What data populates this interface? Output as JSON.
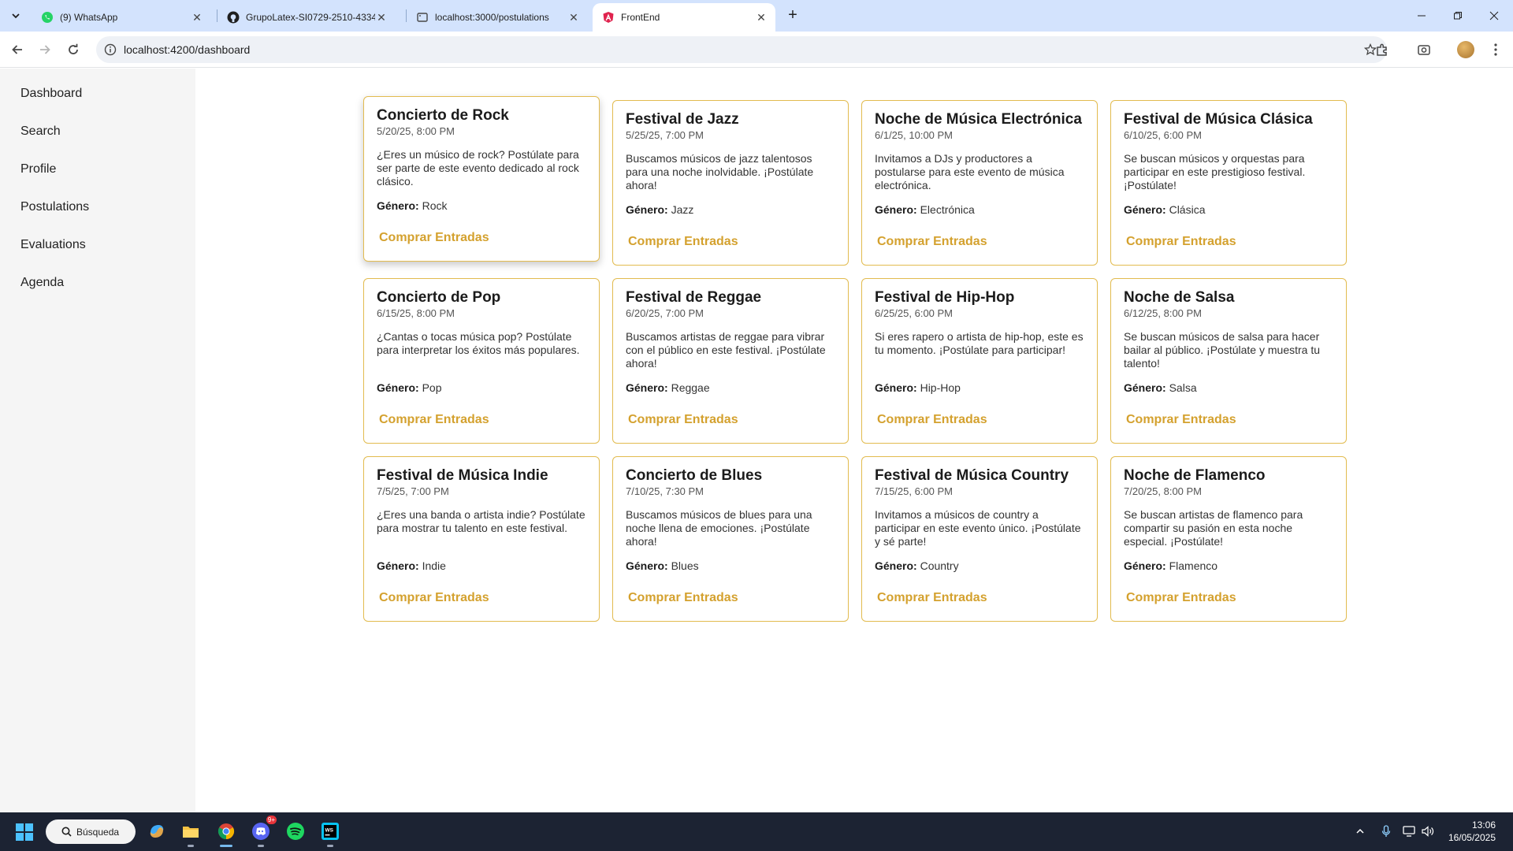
{
  "browser": {
    "tabs": [
      {
        "title": "(9) WhatsApp",
        "icon": "whatsapp-icon"
      },
      {
        "title": "GrupoLatex-SI0729-2510-4334",
        "icon": "github-icon"
      },
      {
        "title": "localhost:3000/postulations",
        "icon": "page-icon"
      },
      {
        "title": "FrontEnd",
        "icon": "angular-icon"
      }
    ],
    "url": "localhost:4200/dashboard"
  },
  "sidebar": {
    "items": [
      {
        "label": "Dashboard"
      },
      {
        "label": "Search"
      },
      {
        "label": "Profile"
      },
      {
        "label": "Postulations"
      },
      {
        "label": "Evaluations"
      },
      {
        "label": "Agenda"
      }
    ]
  },
  "events": [
    {
      "title": "Concierto de Rock",
      "date": "5/20/25, 8:00 PM",
      "description": "¿Eres un músico de rock? Postúlate para ser parte de este evento dedicado al rock clásico.",
      "genre_label": "Género:",
      "genre": "Rock",
      "button": "Comprar Entradas"
    },
    {
      "title": "Festival de Jazz",
      "date": "5/25/25, 7:00 PM",
      "description": "Buscamos músicos de jazz talentosos para una noche inolvidable. ¡Postúlate ahora!",
      "genre_label": "Género:",
      "genre": "Jazz",
      "button": "Comprar Entradas"
    },
    {
      "title": "Noche de Música Electrónica",
      "date": "6/1/25, 10:00 PM",
      "description": "Invitamos a DJs y productores a postularse para este evento de música electrónica.",
      "genre_label": "Género:",
      "genre": "Electrónica",
      "button": "Comprar Entradas"
    },
    {
      "title": "Festival de Música Clásica",
      "date": "6/10/25, 6:00 PM",
      "description": "Se buscan músicos y orquestas para participar en este prestigioso festival. ¡Postúlate!",
      "genre_label": "Género:",
      "genre": "Clásica",
      "button": "Comprar Entradas"
    },
    {
      "title": "Concierto de Pop",
      "date": "6/15/25, 8:00 PM",
      "description": "¿Cantas o tocas música pop? Postúlate para interpretar los éxitos más populares.",
      "genre_label": "Género:",
      "genre": "Pop",
      "button": "Comprar Entradas"
    },
    {
      "title": "Festival de Reggae",
      "date": "6/20/25, 7:00 PM",
      "description": "Buscamos artistas de reggae para vibrar con el público en este festival. ¡Postúlate ahora!",
      "genre_label": "Género:",
      "genre": "Reggae",
      "button": "Comprar Entradas"
    },
    {
      "title": "Festival de Hip-Hop",
      "date": "6/25/25, 6:00 PM",
      "description": "Si eres rapero o artista de hip-hop, este es tu momento. ¡Postúlate para participar!",
      "genre_label": "Género:",
      "genre": "Hip-Hop",
      "button": "Comprar Entradas"
    },
    {
      "title": "Noche de Salsa",
      "date": "6/12/25, 8:00 PM",
      "description": "Se buscan músicos de salsa para hacer bailar al público. ¡Postúlate y muestra tu talento!",
      "genre_label": "Género:",
      "genre": "Salsa",
      "button": "Comprar Entradas"
    },
    {
      "title": "Festival de Música Indie",
      "date": "7/5/25, 7:00 PM",
      "description": "¿Eres una banda o artista indie? Postúlate para mostrar tu talento en este festival.",
      "genre_label": "Género:",
      "genre": "Indie",
      "button": "Comprar Entradas"
    },
    {
      "title": "Concierto de Blues",
      "date": "7/10/25, 7:30 PM",
      "description": "Buscamos músicos de blues para una noche llena de emociones. ¡Postúlate ahora!",
      "genre_label": "Género:",
      "genre": "Blues",
      "button": "Comprar Entradas"
    },
    {
      "title": "Festival de Música Country",
      "date": "7/15/25, 6:00 PM",
      "description": "Invitamos a músicos de country a participar en este evento único. ¡Postúlate y sé parte!",
      "genre_label": "Género:",
      "genre": "Country",
      "button": "Comprar Entradas"
    },
    {
      "title": "Noche de Flamenco",
      "date": "7/20/25, 8:00 PM",
      "description": "Se buscan artistas de flamenco para compartir su pasión en esta noche especial. ¡Postúlate!",
      "genre_label": "Género:",
      "genre": "Flamenco",
      "button": "Comprar Entradas"
    }
  ],
  "colors": {
    "card_border": "#e2bb4f",
    "button_text": "#d4a12e",
    "sidebar_bg": "#f5f5f5",
    "tabbar_bg": "#d3e3fd",
    "taskbar_bg": "#1c2333"
  },
  "taskbar": {
    "search_label": "Búsqueda",
    "discord_badge": "9+",
    "time": "13:06",
    "date": "16/05/2025",
    "apps": [
      "copilot-icon",
      "file-explorer-icon",
      "chrome-icon",
      "discord-icon",
      "spotify-icon",
      "webstorm-icon"
    ]
  }
}
